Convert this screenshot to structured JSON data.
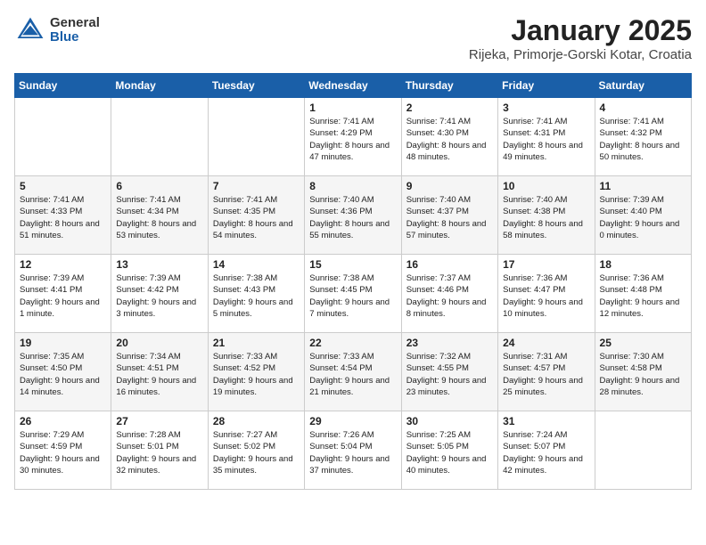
{
  "header": {
    "logo_general": "General",
    "logo_blue": "Blue",
    "title": "January 2025",
    "location": "Rijeka, Primorje-Gorski Kotar, Croatia"
  },
  "days_of_week": [
    "Sunday",
    "Monday",
    "Tuesday",
    "Wednesday",
    "Thursday",
    "Friday",
    "Saturday"
  ],
  "weeks": [
    [
      {
        "day": "",
        "text": ""
      },
      {
        "day": "",
        "text": ""
      },
      {
        "day": "",
        "text": ""
      },
      {
        "day": "1",
        "text": "Sunrise: 7:41 AM\nSunset: 4:29 PM\nDaylight: 8 hours and 47 minutes."
      },
      {
        "day": "2",
        "text": "Sunrise: 7:41 AM\nSunset: 4:30 PM\nDaylight: 8 hours and 48 minutes."
      },
      {
        "day": "3",
        "text": "Sunrise: 7:41 AM\nSunset: 4:31 PM\nDaylight: 8 hours and 49 minutes."
      },
      {
        "day": "4",
        "text": "Sunrise: 7:41 AM\nSunset: 4:32 PM\nDaylight: 8 hours and 50 minutes."
      }
    ],
    [
      {
        "day": "5",
        "text": "Sunrise: 7:41 AM\nSunset: 4:33 PM\nDaylight: 8 hours and 51 minutes."
      },
      {
        "day": "6",
        "text": "Sunrise: 7:41 AM\nSunset: 4:34 PM\nDaylight: 8 hours and 53 minutes."
      },
      {
        "day": "7",
        "text": "Sunrise: 7:41 AM\nSunset: 4:35 PM\nDaylight: 8 hours and 54 minutes."
      },
      {
        "day": "8",
        "text": "Sunrise: 7:40 AM\nSunset: 4:36 PM\nDaylight: 8 hours and 55 minutes."
      },
      {
        "day": "9",
        "text": "Sunrise: 7:40 AM\nSunset: 4:37 PM\nDaylight: 8 hours and 57 minutes."
      },
      {
        "day": "10",
        "text": "Sunrise: 7:40 AM\nSunset: 4:38 PM\nDaylight: 8 hours and 58 minutes."
      },
      {
        "day": "11",
        "text": "Sunrise: 7:39 AM\nSunset: 4:40 PM\nDaylight: 9 hours and 0 minutes."
      }
    ],
    [
      {
        "day": "12",
        "text": "Sunrise: 7:39 AM\nSunset: 4:41 PM\nDaylight: 9 hours and 1 minute."
      },
      {
        "day": "13",
        "text": "Sunrise: 7:39 AM\nSunset: 4:42 PM\nDaylight: 9 hours and 3 minutes."
      },
      {
        "day": "14",
        "text": "Sunrise: 7:38 AM\nSunset: 4:43 PM\nDaylight: 9 hours and 5 minutes."
      },
      {
        "day": "15",
        "text": "Sunrise: 7:38 AM\nSunset: 4:45 PM\nDaylight: 9 hours and 7 minutes."
      },
      {
        "day": "16",
        "text": "Sunrise: 7:37 AM\nSunset: 4:46 PM\nDaylight: 9 hours and 8 minutes."
      },
      {
        "day": "17",
        "text": "Sunrise: 7:36 AM\nSunset: 4:47 PM\nDaylight: 9 hours and 10 minutes."
      },
      {
        "day": "18",
        "text": "Sunrise: 7:36 AM\nSunset: 4:48 PM\nDaylight: 9 hours and 12 minutes."
      }
    ],
    [
      {
        "day": "19",
        "text": "Sunrise: 7:35 AM\nSunset: 4:50 PM\nDaylight: 9 hours and 14 minutes."
      },
      {
        "day": "20",
        "text": "Sunrise: 7:34 AM\nSunset: 4:51 PM\nDaylight: 9 hours and 16 minutes."
      },
      {
        "day": "21",
        "text": "Sunrise: 7:33 AM\nSunset: 4:52 PM\nDaylight: 9 hours and 19 minutes."
      },
      {
        "day": "22",
        "text": "Sunrise: 7:33 AM\nSunset: 4:54 PM\nDaylight: 9 hours and 21 minutes."
      },
      {
        "day": "23",
        "text": "Sunrise: 7:32 AM\nSunset: 4:55 PM\nDaylight: 9 hours and 23 minutes."
      },
      {
        "day": "24",
        "text": "Sunrise: 7:31 AM\nSunset: 4:57 PM\nDaylight: 9 hours and 25 minutes."
      },
      {
        "day": "25",
        "text": "Sunrise: 7:30 AM\nSunset: 4:58 PM\nDaylight: 9 hours and 28 minutes."
      }
    ],
    [
      {
        "day": "26",
        "text": "Sunrise: 7:29 AM\nSunset: 4:59 PM\nDaylight: 9 hours and 30 minutes."
      },
      {
        "day": "27",
        "text": "Sunrise: 7:28 AM\nSunset: 5:01 PM\nDaylight: 9 hours and 32 minutes."
      },
      {
        "day": "28",
        "text": "Sunrise: 7:27 AM\nSunset: 5:02 PM\nDaylight: 9 hours and 35 minutes."
      },
      {
        "day": "29",
        "text": "Sunrise: 7:26 AM\nSunset: 5:04 PM\nDaylight: 9 hours and 37 minutes."
      },
      {
        "day": "30",
        "text": "Sunrise: 7:25 AM\nSunset: 5:05 PM\nDaylight: 9 hours and 40 minutes."
      },
      {
        "day": "31",
        "text": "Sunrise: 7:24 AM\nSunset: 5:07 PM\nDaylight: 9 hours and 42 minutes."
      },
      {
        "day": "",
        "text": ""
      }
    ]
  ]
}
